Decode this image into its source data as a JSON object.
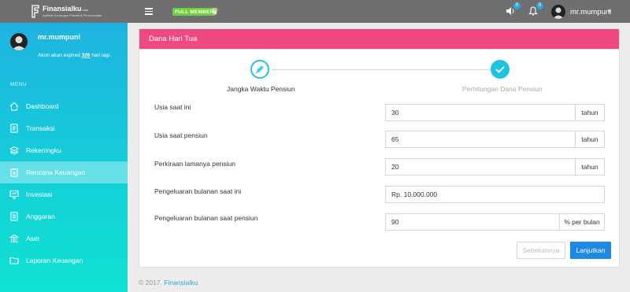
{
  "brand": {
    "name": "Finansialku",
    "suffix": ".com",
    "tagline": "Aplikasi Keuangan Pribadi & Perencanaan"
  },
  "topbar": {
    "membership": "FULL MEMBER",
    "speaker_count": "0",
    "bell_count": "0",
    "username": "mr.mumpuni"
  },
  "sidebar": {
    "username": "mr.mumpuni",
    "expiry_prefix": "Akun akan expired",
    "expiry_days": "326",
    "expiry_suffix": "hari lagi.",
    "menu_label": "MENU",
    "items": [
      {
        "label": "Dashboard",
        "icon": "home-icon"
      },
      {
        "label": "Transaksi",
        "icon": "receipt-icon"
      },
      {
        "label": "Rekeningku",
        "icon": "layers-icon"
      },
      {
        "label": "Rencana Keuangan",
        "icon": "clipboard-icon"
      },
      {
        "label": "Investasi",
        "icon": "monitor-icon"
      },
      {
        "label": "Anggaran",
        "icon": "list-icon"
      },
      {
        "label": "Aset",
        "icon": "bank-icon"
      },
      {
        "label": "Laporan Keuangan",
        "icon": "folder-icon"
      }
    ],
    "active_item": "Rencana Keuangan"
  },
  "card": {
    "title": "Dana Hari Tua",
    "steps": [
      {
        "label": "Jangka Waktu Pensiun",
        "state": "current"
      },
      {
        "label": "Perhitungan Dana Pensiun",
        "state": "done"
      }
    ],
    "fields": [
      {
        "label": "Usia saat ini",
        "value": "30",
        "unit": "tahun"
      },
      {
        "label": "Usia saat pensiun",
        "value": "65",
        "unit": "tahun"
      },
      {
        "label": "Perkiraan lamanya pensiun",
        "value": "20",
        "unit": "tahun"
      },
      {
        "label": "Pengeluaran bulanan saat ini",
        "value": "Rp. 10.000.000",
        "unit": ""
      },
      {
        "label": "Pengeluaran bulanan saat pensiun",
        "value": "90",
        "unit": "% per bulan"
      }
    ],
    "buttons": {
      "prev": "Sebelumnya",
      "next": "Lanjutkan"
    }
  },
  "footer": {
    "copyright": "© 2017.",
    "link": "Finansialku"
  },
  "colors": {
    "header_pink": "#ef4a7f",
    "accent_cyan": "#1ec3e0",
    "primary_blue": "#1e88e5",
    "badge_green": "#6fcf3a"
  }
}
